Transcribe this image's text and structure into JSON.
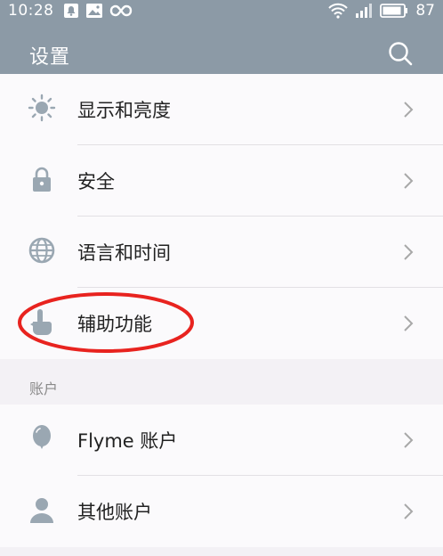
{
  "status_bar": {
    "time": "10:28",
    "battery_level": "87",
    "icons": [
      "notification-icon",
      "image-icon",
      "infinity-icon",
      "wifi-icon",
      "signal-icon",
      "battery-icon"
    ]
  },
  "app_bar": {
    "title": "设置",
    "search_icon": "search-icon"
  },
  "settings_group_1": [
    {
      "label": "显示和亮度",
      "icon": "brightness-icon"
    },
    {
      "label": "安全",
      "icon": "lock-icon"
    },
    {
      "label": "语言和时间",
      "icon": "globe-icon"
    },
    {
      "label": "辅助功能",
      "icon": "hand-pointer-icon"
    }
  ],
  "accounts_section": {
    "header": "账户",
    "items": [
      {
        "label": "Flyme 账户",
        "icon": "balloon-icon"
      },
      {
        "label": "其他账户",
        "icon": "person-icon"
      }
    ]
  },
  "annotation": {
    "color": "#e8231f",
    "target": "辅助功能"
  },
  "colors": {
    "app_bar": "#8c9aa6",
    "background": "#f3f1f5",
    "list": "#fbfafc",
    "icon": "#9aa7b2"
  }
}
